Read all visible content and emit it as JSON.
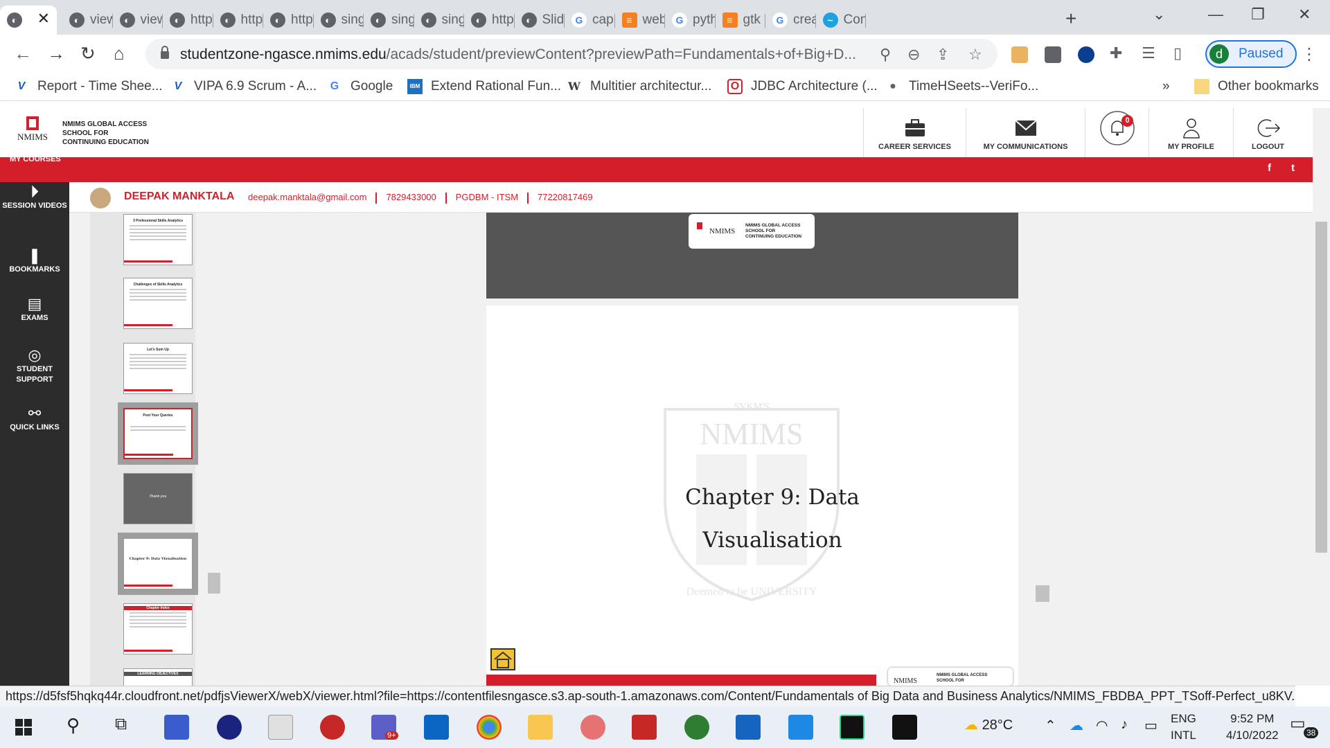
{
  "tabs": [
    {
      "label": "view",
      "icon": "globe-icon"
    },
    {
      "label": "view",
      "icon": "globe-icon"
    },
    {
      "label": "http",
      "icon": "globe-icon"
    },
    {
      "label": "http",
      "icon": "globe-icon"
    },
    {
      "label": "http",
      "icon": "globe-icon"
    },
    {
      "label": "sing",
      "icon": "globe-icon"
    },
    {
      "label": "sing",
      "icon": "globe-icon"
    },
    {
      "label": "sing",
      "icon": "globe-icon"
    },
    {
      "label": "http",
      "icon": "globe-icon"
    },
    {
      "label": "Slid",
      "icon": "globe-icon"
    },
    {
      "label": "cap",
      "icon": "google-icon"
    },
    {
      "label": "web",
      "icon": "stackoverflow-icon"
    },
    {
      "label": "pyth",
      "icon": "google-icon"
    },
    {
      "label": "gtk",
      "icon": "stackoverflow-icon"
    },
    {
      "label": "crea",
      "icon": "google-icon"
    },
    {
      "label": "Con",
      "icon": "fish-icon"
    }
  ],
  "address": {
    "domain": "studentzone-ngasce.nmims.edu",
    "path": "/acads/student/previewContent?previewPath=Fundamentals+of+Big+D..."
  },
  "profile": {
    "initial": "d",
    "label": "Paused"
  },
  "bookmarks": [
    {
      "label": "Report - Time Shee...",
      "icon": "V"
    },
    {
      "label": "VIPA 6.9 Scrum - A...",
      "icon": "V"
    },
    {
      "label": "Google",
      "icon": "G"
    },
    {
      "label": "Extend Rational Fun...",
      "icon": "IBM"
    },
    {
      "label": "Multitier architectur...",
      "icon": "W"
    },
    {
      "label": "JDBC Architecture (...",
      "icon": "O"
    },
    {
      "label": "TimeHSeets--VeriFo...",
      "icon": "●"
    }
  ],
  "bookmarks_more": "»",
  "other_bookmarks": "Other bookmarks",
  "site": {
    "logo_name": "NMIMS",
    "logo_lines": [
      "NMIMS GLOBAL ACCESS",
      "SCHOOL FOR",
      "CONTINUING EDUCATION"
    ],
    "nav": [
      {
        "label": "CAREER SERVICES",
        "icon": "briefcase-icon"
      },
      {
        "label": "MY COMMUNICATIONS",
        "icon": "envelope-icon"
      },
      {
        "label": "",
        "icon": "bell-icon",
        "badge": "0"
      },
      {
        "label": "MY PROFILE",
        "icon": "user-icon"
      },
      {
        "label": "LOGOUT",
        "icon": "logout-icon"
      }
    ],
    "my_courses": "MY COURSES",
    "social": [
      "f",
      "t"
    ]
  },
  "sidebar": [
    {
      "label": "SESSION VIDEOS",
      "icon": "play-circle-icon"
    },
    {
      "label": "BOOKMARKS",
      "icon": "bookmark-icon"
    },
    {
      "label": "EXAMS",
      "icon": "exam-icon"
    },
    {
      "label": "STUDENT SUPPORT",
      "icon": "lifebuoy-icon"
    },
    {
      "label": "QUICK LINKS",
      "icon": "link-icon"
    }
  ],
  "user": {
    "name": "DEEPAK MANKTALA",
    "email": "deepak.manktala@gmail.com",
    "phone": "7829433000",
    "program": "PGDBM - ITSM",
    "student_id": "77220817469"
  },
  "thumbnails": [
    {
      "title": "3 Professional Skills Analytics",
      "style": "text"
    },
    {
      "title": "Challenges of Skills Analytics",
      "style": "text"
    },
    {
      "title": "Let's Sum Up",
      "style": "text"
    },
    {
      "title": "Post Your Queries",
      "style": "queries"
    },
    {
      "title": "Thank you",
      "style": "dark"
    },
    {
      "title": "Chapter 9: Data Visualisation",
      "style": "chapter"
    },
    {
      "title": "Chapter Index",
      "style": "index"
    },
    {
      "title": "LEARNING OBJECTIVES",
      "style": "text"
    }
  ],
  "slide": {
    "title_line1": "Chapter 9: Data",
    "title_line2": "Visualisation",
    "watermark": "NMIMS",
    "watermark_top": "SVKM'S",
    "watermark_bottom": "Deemed to be UNIVERSITY"
  },
  "status_url": "https://d5fsf5hqkq44r.cloudfront.net/pdfjsViewerX/webX/viewer.html?file=https://contentfilesngasce.s3.ap-south-1.amazonaws.com/Content/Fundamentals of Big Data and Business Analytics/NMIMS_FBDBA_PPT_TSoff-Perfect_u8KV...",
  "taskbar": {
    "temperature": "28°C",
    "lang_top": "ENG",
    "lang_bottom": "INTL",
    "time": "9:52 PM",
    "date": "4/10/2022",
    "notifications": "38",
    "teams_badge": "9+"
  },
  "colors": {
    "brand_red": "#d41f2a",
    "sidebar_dark": "#2c2c2c",
    "chrome_tabbar": "#dee1e6"
  }
}
